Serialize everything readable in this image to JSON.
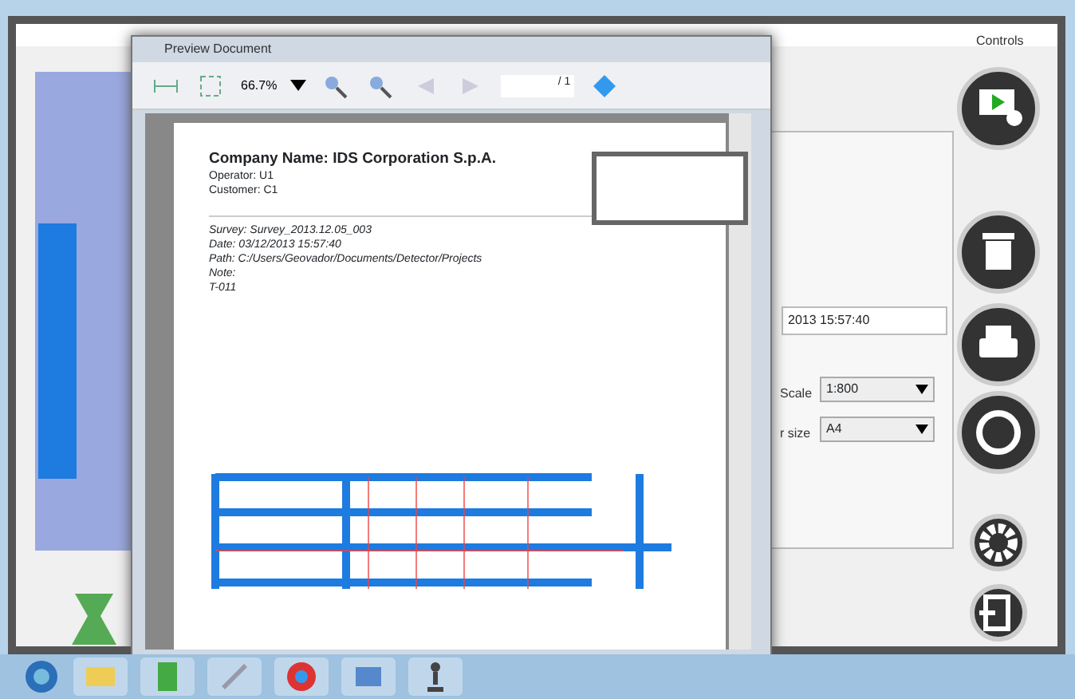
{
  "app": {
    "controls_label": "Controls"
  },
  "preview": {
    "title": "Preview Document",
    "zoom": "66.7%",
    "page_count": "/ 1",
    "company": "Company Name: IDS Corporation S.p.A.",
    "header_lines": [
      "Operator: U1",
      "Customer: C1"
    ],
    "details": [
      "Survey: Survey_2013.12.05_003",
      "Date: 03/12/2013 15:57:40",
      "Path: C:/Users/Geovador/Documents/Detector/Projects",
      "Note:",
      "T-011"
    ]
  },
  "side_panel": {
    "date_value": "2013 15:57:40",
    "scale_label": "Scale",
    "scale_value": "1:800",
    "paper_label": "r size",
    "paper_value": "A4"
  },
  "taskbar": {
    "apps": [
      {
        "kind": "folder"
      },
      {
        "kind": "sheet"
      },
      {
        "kind": "paint"
      },
      {
        "kind": "browser"
      },
      {
        "kind": "media"
      },
      {
        "kind": "figure"
      }
    ]
  }
}
